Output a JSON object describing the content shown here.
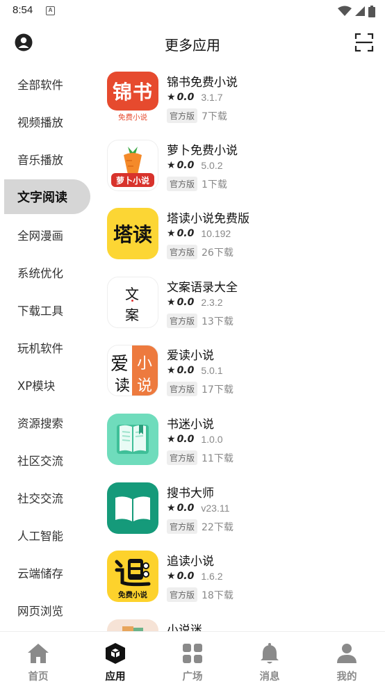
{
  "status_bar": {
    "time": "8:54",
    "notification_glyph": "A"
  },
  "header": {
    "title": "更多应用"
  },
  "sidebar": {
    "items": [
      {
        "label": "全部软件"
      },
      {
        "label": "视频播放"
      },
      {
        "label": "音乐播放"
      },
      {
        "label": "文字阅读",
        "active": true
      },
      {
        "label": "全网漫画"
      },
      {
        "label": "系统优化"
      },
      {
        "label": "下载工具"
      },
      {
        "label": "玩机软件"
      },
      {
        "label": "XP模块"
      },
      {
        "label": "资源搜索"
      },
      {
        "label": "社区交流"
      },
      {
        "label": "社交交流"
      },
      {
        "label": "人工智能"
      },
      {
        "label": "云端储存"
      },
      {
        "label": "网页浏览"
      }
    ]
  },
  "apps": [
    {
      "name": "锦书免费小说",
      "rating": "0.0",
      "version": "3.1.7",
      "badge": "官方版",
      "downloads": "7下载",
      "icon_text": "锦书",
      "icon_sub": "免费小说"
    },
    {
      "name": "萝卜免费小说",
      "rating": "0.0",
      "version": "5.0.2",
      "badge": "官方版",
      "downloads": "1下载",
      "icon_text": "萝卜小说"
    },
    {
      "name": "塔读小说免费版",
      "rating": "0.0",
      "version": "10.192",
      "badge": "官方版",
      "downloads": "26下载",
      "icon_text": "塔读"
    },
    {
      "name": "文案语录大全",
      "rating": "0.0",
      "version": "2.3.2",
      "badge": "官方版",
      "downloads": "13下载",
      "icon_text": "文",
      "icon_sub": "案"
    },
    {
      "name": "爱读小说",
      "rating": "0.0",
      "version": "5.0.1",
      "badge": "官方版",
      "downloads": "17下载",
      "icon_text": "爱",
      "icon_sub": "读",
      "icon_text_2": "小",
      "icon_sub_2": "说"
    },
    {
      "name": "书迷小说",
      "rating": "0.0",
      "version": "1.0.0",
      "badge": "官方版",
      "downloads": "11下载"
    },
    {
      "name": "搜书大师",
      "rating": "0.0",
      "version": "v23.11",
      "badge": "官方版",
      "downloads": "22下载"
    },
    {
      "name": "追读小说",
      "rating": "0.0",
      "version": "1.6.2",
      "badge": "官方版",
      "downloads": "18下载",
      "icon_sub": "免费小说"
    },
    {
      "name": "小说迷"
    }
  ],
  "bottom_nav": {
    "items": [
      {
        "label": "首页",
        "icon": "home-icon"
      },
      {
        "label": "应用",
        "icon": "apps-cube-icon",
        "active": true
      },
      {
        "label": "广场",
        "icon": "grid-icon"
      },
      {
        "label": "消息",
        "icon": "bell-icon"
      },
      {
        "label": "我的",
        "icon": "person-icon"
      }
    ]
  },
  "colors": {
    "sidebar_active_bg": "#d6d6d6",
    "jinshu_red": "#e64a2e",
    "tadu_yellow": "#fcd634",
    "shumi_green": "#6fdcbc",
    "soushu_teal": "#159a7a",
    "zhuidu_yellow": "#fdd22c"
  }
}
